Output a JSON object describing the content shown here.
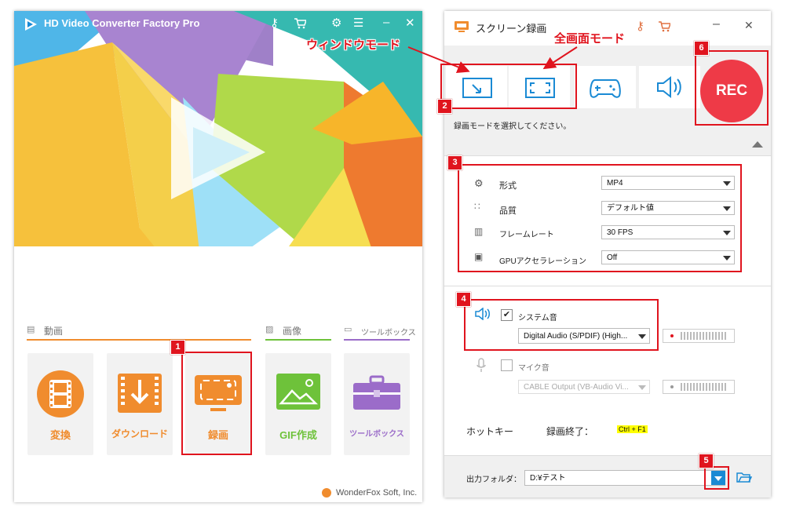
{
  "main_app": {
    "title": "HD Video Converter Factory Pro",
    "categories": {
      "video": "動画",
      "image": "画像",
      "tools": "ツールボックス"
    },
    "tiles": [
      {
        "label": "変換",
        "icon": "film-icon",
        "color": "#f08c2e"
      },
      {
        "label": "ダウンロード",
        "icon": "download-icon",
        "color": "#f08c2e"
      },
      {
        "label": "録画",
        "icon": "screen-record-icon",
        "color": "#f08c2e"
      },
      {
        "label": "GIF作成",
        "icon": "gif-image-icon",
        "color": "#6ec23a"
      },
      {
        "label": "ツールボックス",
        "icon": "toolbox-icon",
        "color": "#9b6cc9"
      }
    ],
    "footer": "WonderFox Soft, Inc."
  },
  "recorder": {
    "title": "スクリーン録画",
    "hint": "録画モードを選択してください。",
    "rec_label": "REC",
    "settings": [
      {
        "label": "形式",
        "value": "MP4"
      },
      {
        "label": "品質",
        "value": "デフォルト値"
      },
      {
        "label": "フレームレート",
        "value": "30 FPS"
      },
      {
        "label": "GPUアクセラレーション",
        "value": "Off"
      }
    ],
    "system_audio": {
      "label": "システム音",
      "device": "Digital Audio (S/PDIF) (High...",
      "checked": true
    },
    "mic": {
      "label": "マイク音",
      "device": "CABLE Output (VB-Audio Vi...",
      "checked": false
    },
    "hotkey_label": "ホットキー",
    "stop_label": "録画終了：",
    "stop_key": "Ctrl + F1",
    "output_label": "出力フォルダ：",
    "output_path": "D:¥テスト"
  },
  "annotations": {
    "window_mode": "ウィンドウモード",
    "fullscreen_mode": "全画面モード",
    "badges": [
      "1",
      "2",
      "3",
      "4",
      "5",
      "6"
    ]
  },
  "colors": {
    "accent_red": "#e0141e",
    "accent_blue": "#1a8ad4",
    "orange": "#f08c2e",
    "rec_red": "#ee3a47"
  }
}
